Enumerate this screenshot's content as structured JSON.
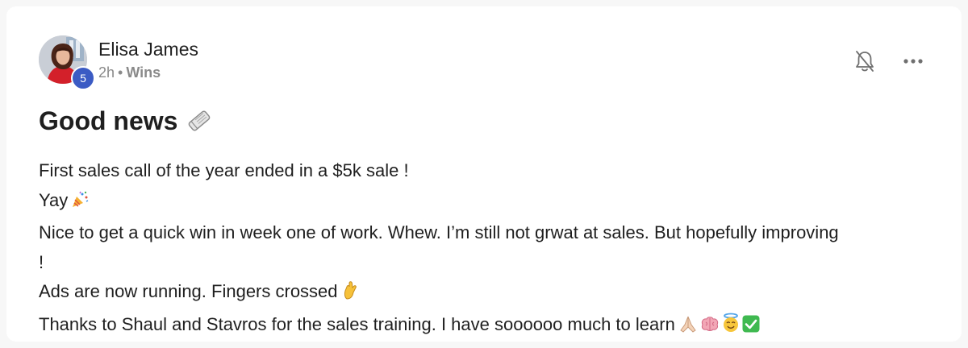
{
  "post": {
    "author": {
      "name": "Elisa James",
      "level": "5",
      "avatar_icon": "avatar-photo"
    },
    "meta": {
      "time": "2h",
      "separator": "•",
      "category": "Wins"
    },
    "actions": {
      "notify_icon": "bell-off-icon",
      "more_icon": "more-horizontal-icon"
    },
    "title": "Good news",
    "title_emoji": "rolled-up-newspaper",
    "lines": [
      "First sales call of the year ended in a $5k sale !",
      "Yay",
      "Nice to get a quick win in week one of work. Whew. I’m still not grwat at sales. But hopefully improving",
      "!",
      "Ads are now running. Fingers crossed",
      "Thanks to Shaul and Stavros for the sales training. I have soooooo much to learn"
    ],
    "emojis": {
      "line2": "party-popper",
      "line5": "crossed-fingers",
      "line6": [
        "folded-hands",
        "brain",
        "smiling-face-with-halo",
        "check-mark-button"
      ]
    }
  },
  "colors": {
    "badge": "#3b5bc4",
    "meta_text": "#8a8a8a",
    "text": "#1f1f1f",
    "check_green": "#3fb950"
  }
}
